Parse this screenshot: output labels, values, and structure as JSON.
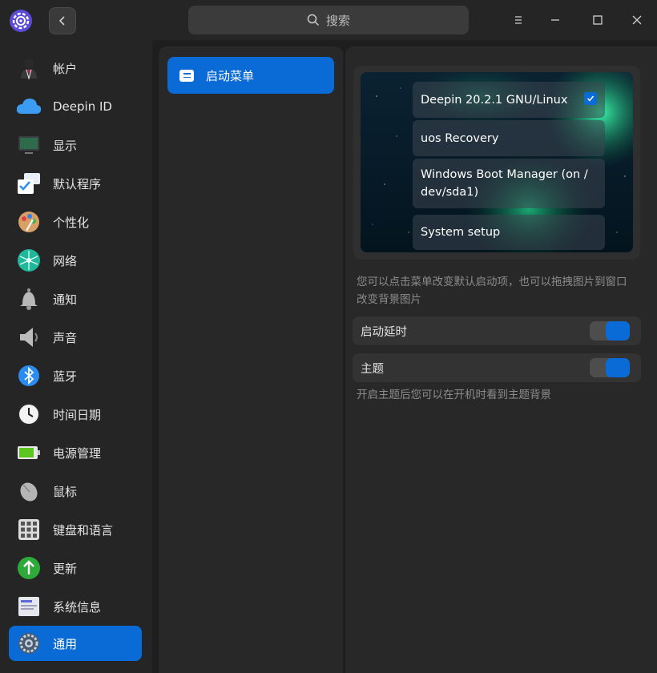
{
  "titlebar": {
    "search_placeholder": "搜索"
  },
  "sidebar": {
    "items": [
      {
        "label": "帐户",
        "icon": "account-icon"
      },
      {
        "label": "Deepin ID",
        "icon": "cloud-icon"
      },
      {
        "label": "显示",
        "icon": "display-icon"
      },
      {
        "label": "默认程序",
        "icon": "default-apps-icon"
      },
      {
        "label": "个性化",
        "icon": "palette-icon"
      },
      {
        "label": "网络",
        "icon": "network-icon"
      },
      {
        "label": "通知",
        "icon": "bell-icon"
      },
      {
        "label": "声音",
        "icon": "speaker-icon"
      },
      {
        "label": "蓝牙",
        "icon": "bluetooth-icon"
      },
      {
        "label": "时间日期",
        "icon": "clock-icon"
      },
      {
        "label": "电源管理",
        "icon": "battery-icon"
      },
      {
        "label": "鼠标",
        "icon": "mouse-icon"
      },
      {
        "label": "键盘和语言",
        "icon": "keyboard-icon"
      },
      {
        "label": "更新",
        "icon": "update-icon"
      },
      {
        "label": "系统信息",
        "icon": "system-info-icon"
      },
      {
        "label": "通用",
        "icon": "general-gear-icon",
        "active": true
      }
    ]
  },
  "middle": {
    "items": [
      {
        "label": "启动菜单",
        "active": true
      }
    ]
  },
  "boot_menu": {
    "entries": [
      {
        "label": "Deepin 20.2.1 GNU/Linux",
        "default": true
      },
      {
        "label": "uos Recovery"
      },
      {
        "label": "Windows Boot Manager (on /\ndev/sda1)"
      },
      {
        "label": "System setup"
      }
    ],
    "hint": "您可以点击菜单改变默认启动项，也可以拖拽图片到窗口改变背景图片",
    "delay_label": "启动延时",
    "delay_enabled": true,
    "theme_label": "主题",
    "theme_enabled": true,
    "theme_hint": "开启主题后您可以在开机时看到主题背景"
  },
  "colors": {
    "accent": "#0a6bd6",
    "background": "#1e1e1e",
    "panel": "#282828"
  }
}
